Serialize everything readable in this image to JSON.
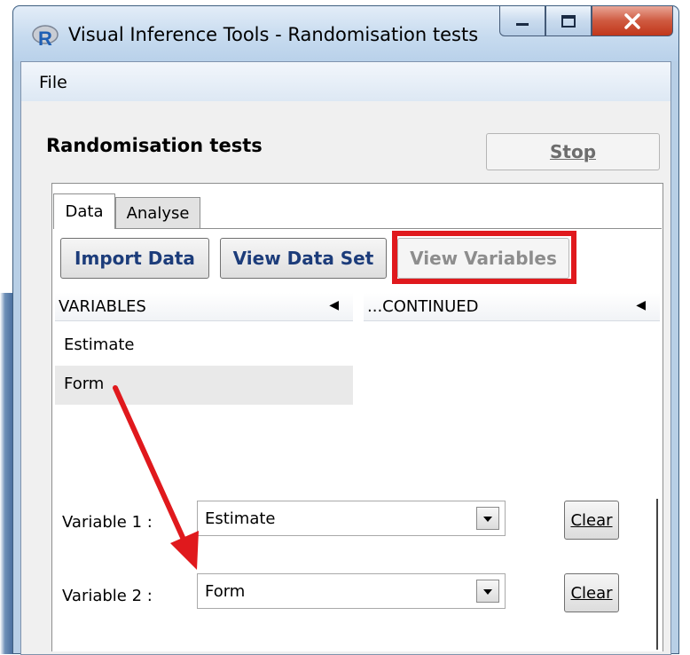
{
  "window": {
    "title": "Visual Inference Tools - Randomisation tests",
    "app_icon": "r-logo-icon"
  },
  "menu": {
    "file": "File"
  },
  "header": {
    "title": "Randomisation tests",
    "stop_label": "Stop"
  },
  "tabs": [
    {
      "label": "Data",
      "selected": true
    },
    {
      "label": "Analyse",
      "selected": false
    }
  ],
  "toolbar": {
    "import_label": "Import Data",
    "view_data_label": "View Data Set",
    "view_variables_label": "View Variables"
  },
  "columns": {
    "variables": "VARIABLES",
    "continued": "...CONTINUED"
  },
  "variables": [
    "Estimate",
    "Form"
  ],
  "variable_selectors": [
    {
      "label": "Variable 1 :",
      "value": "Estimate",
      "clear_label": "Clear"
    },
    {
      "label": "Variable 2 :",
      "value": "Form",
      "clear_label": "Clear"
    }
  ],
  "annotations": {
    "highlight_color": "#e0191d",
    "arrow_color": "#e0191d"
  }
}
